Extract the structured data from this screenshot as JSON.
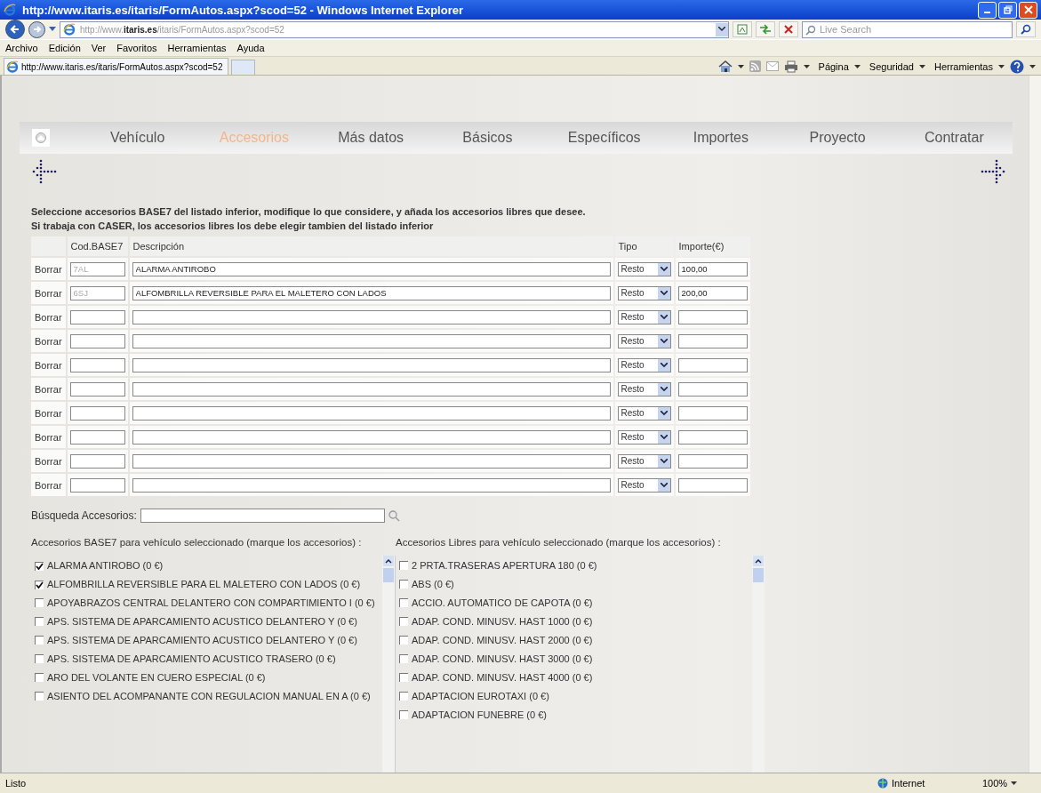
{
  "window": {
    "title": "http://www.itaris.es/itaris/FormAutos.aspx?scod=52 - Windows Internet Explorer"
  },
  "address_bar": {
    "url_host": "http://www.",
    "url_domain": "itaris.es",
    "url_path": "/itaris/FormAutos.aspx?scod=52",
    "search_placeholder": "Live Search"
  },
  "menu": [
    "Archivo",
    "Edición",
    "Ver",
    "Favoritos",
    "Herramientas",
    "Ayuda"
  ],
  "browser_tab": {
    "title": "http://www.itaris.es/itaris/FormAutos.aspx?scod=52"
  },
  "command_bar": [
    "Página",
    "Seguridad",
    "Herramientas"
  ],
  "nav": {
    "tabs": [
      {
        "label": "Vehículo",
        "selected": false
      },
      {
        "label": "Accesorios",
        "selected": true
      },
      {
        "label": "Más datos",
        "selected": false
      },
      {
        "label": "Básicos",
        "selected": false
      },
      {
        "label": "Específicos",
        "selected": false
      },
      {
        "label": "Importes",
        "selected": false
      },
      {
        "label": "Proyecto",
        "selected": false
      },
      {
        "label": "Contratar",
        "selected": false
      }
    ]
  },
  "instructions": [
    "Seleccione accesorios BASE7 del listado inferior, modifique lo que considere, y añada los accesorios libres que desee.",
    "Si trabaja con CASER, los accesorios libres los debe elegir tambien del listado inferior"
  ],
  "table": {
    "columns": [
      "Cod.BASE7",
      "Descripción",
      "Tipo",
      "Importe(€)"
    ],
    "rows": [
      {
        "delete": "Borrar",
        "code": "7AL",
        "description": "ALARMA ANTIROBO",
        "type": "Resto",
        "amount": "100,00"
      },
      {
        "delete": "Borrar",
        "code": "6SJ",
        "description": "ALFOMBRILLA REVERSIBLE PARA EL MALETERO CON LADOS",
        "type": "Resto",
        "amount": "200,00"
      },
      {
        "delete": "Borrar",
        "type": "Resto"
      },
      {
        "delete": "Borrar",
        "type": "Resto"
      },
      {
        "delete": "Borrar",
        "type": "Resto"
      },
      {
        "delete": "Borrar",
        "type": "Resto"
      },
      {
        "delete": "Borrar",
        "type": "Resto"
      },
      {
        "delete": "Borrar",
        "type": "Resto"
      },
      {
        "delete": "Borrar",
        "type": "Resto"
      },
      {
        "delete": "Borrar",
        "type": "Resto"
      }
    ]
  },
  "search": {
    "label": "Búsqueda Accesorios:"
  },
  "base7": {
    "title": "Accesorios BASE7 para vehículo seleccionado (marque los accesorios) :",
    "items": [
      {
        "label": "ALARMA ANTIROBO (0 €)",
        "checked": true
      },
      {
        "label": "ALFOMBRILLA REVERSIBLE PARA EL MALETERO CON LADOS (0 €)",
        "checked": true
      },
      {
        "label": "APOYABRAZOS CENTRAL DELANTERO CON COMPARTIMIENTO I (0 €)",
        "checked": false
      },
      {
        "label": "APS. SISTEMA DE APARCAMIENTO ACUSTICO DELANTERO Y (0 €)",
        "checked": false
      },
      {
        "label": "APS. SISTEMA DE APARCAMIENTO ACUSTICO DELANTERO Y (0 €)",
        "checked": false
      },
      {
        "label": "APS. SISTEMA DE APARCAMIENTO ACUSTICO TRASERO (0 €)",
        "checked": false
      },
      {
        "label": "ARO DEL VOLANTE EN CUERO ESPECIAL (0 €)",
        "checked": false
      },
      {
        "label": "ASIENTO DEL ACOMPANANTE CON REGULACION MANUAL EN A (0 €)",
        "checked": false
      }
    ]
  },
  "libres": {
    "title": "Accesorios Libres para vehículo seleccionado (marque los accesorios) :",
    "items": [
      {
        "label": "2 PRTA.TRASERAS APERTURA 180 (0 €)",
        "checked": false
      },
      {
        "label": "ABS (0 €)",
        "checked": false
      },
      {
        "label": "ACCIO. AUTOMATICO DE CAPOTA (0 €)",
        "checked": false
      },
      {
        "label": "ADAP. COND. MINUSV. HAST 1000 (0 €)",
        "checked": false
      },
      {
        "label": "ADAP. COND. MINUSV. HAST 2000 (0 €)",
        "checked": false
      },
      {
        "label": "ADAP. COND. MINUSV. HAST 3000 (0 €)",
        "checked": false
      },
      {
        "label": "ADAP. COND. MINUSV. HAST 4000 (0 €)",
        "checked": false
      },
      {
        "label": "ADAPTACION EUROTAXI (0 €)",
        "checked": false
      },
      {
        "label": "ADAPTACION FUNEBRE (0 €)",
        "checked": false
      }
    ]
  },
  "status_bar": {
    "text": "Listo",
    "zone": "Internet",
    "zoom": "100%"
  }
}
